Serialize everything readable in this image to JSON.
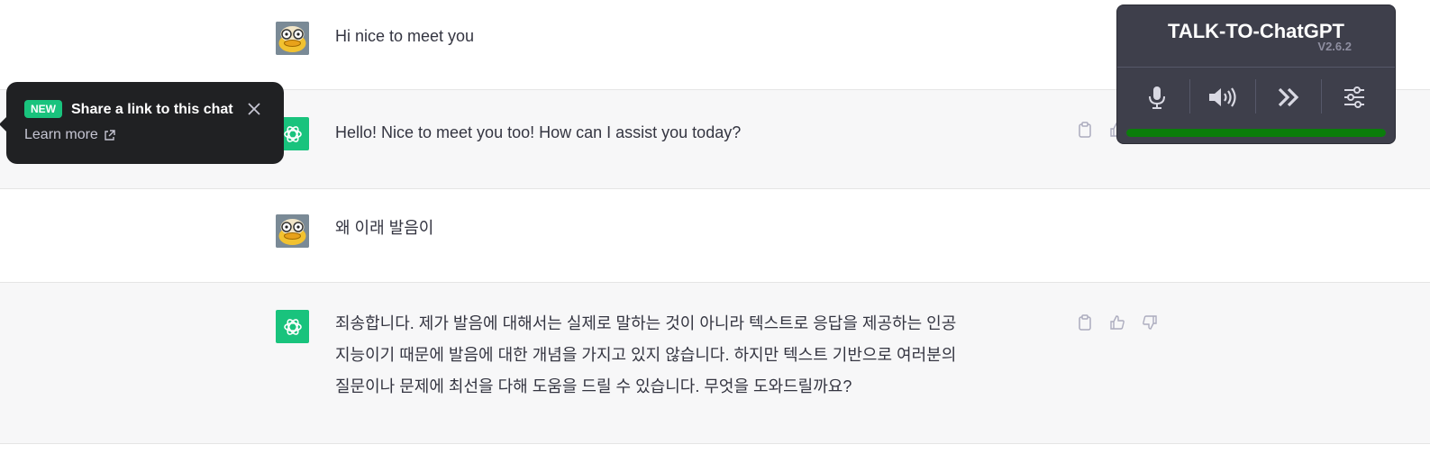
{
  "conversation": {
    "messages": [
      {
        "role": "user",
        "text": "Hi nice to meet you"
      },
      {
        "role": "assistant",
        "text": "Hello! Nice to meet you too! How can I assist you today?"
      },
      {
        "role": "user",
        "text": "왜 이래 발음이"
      },
      {
        "role": "assistant",
        "lines": [
          "죄송합니다. 제가 발음에 대해서는 실제로 말하는 것이 아니라 텍스트로 응답을 제공하는 인공",
          "지능이기 때문에 발음에 대한 개념을 가지고 있지 않습니다. 하지만 텍스트 기반으로 여러분의",
          "질문이나 문제에 최선을 다해 도움을 드릴 수 있습니다. 무엇을 도와드릴까요?"
        ]
      }
    ]
  },
  "tooltip": {
    "badge": "NEW",
    "title": "Share a link to this chat",
    "learn_more": "Learn more",
    "close_icon": "close-icon",
    "external_icon": "external-link-icon"
  },
  "talk_panel": {
    "title": "TALK-TO-ChatGPT",
    "version": "V2.6.2",
    "buttons": [
      "microphone-icon",
      "speaker-icon",
      "skip-icon",
      "settings-sliders-icon"
    ],
    "progress": 1.0,
    "progress_color": "#0a7d0a"
  },
  "colors": {
    "assistant_avatar": "#19c37d",
    "panel_bg": "#3e3f4b",
    "tooltip_bg": "#202123"
  }
}
